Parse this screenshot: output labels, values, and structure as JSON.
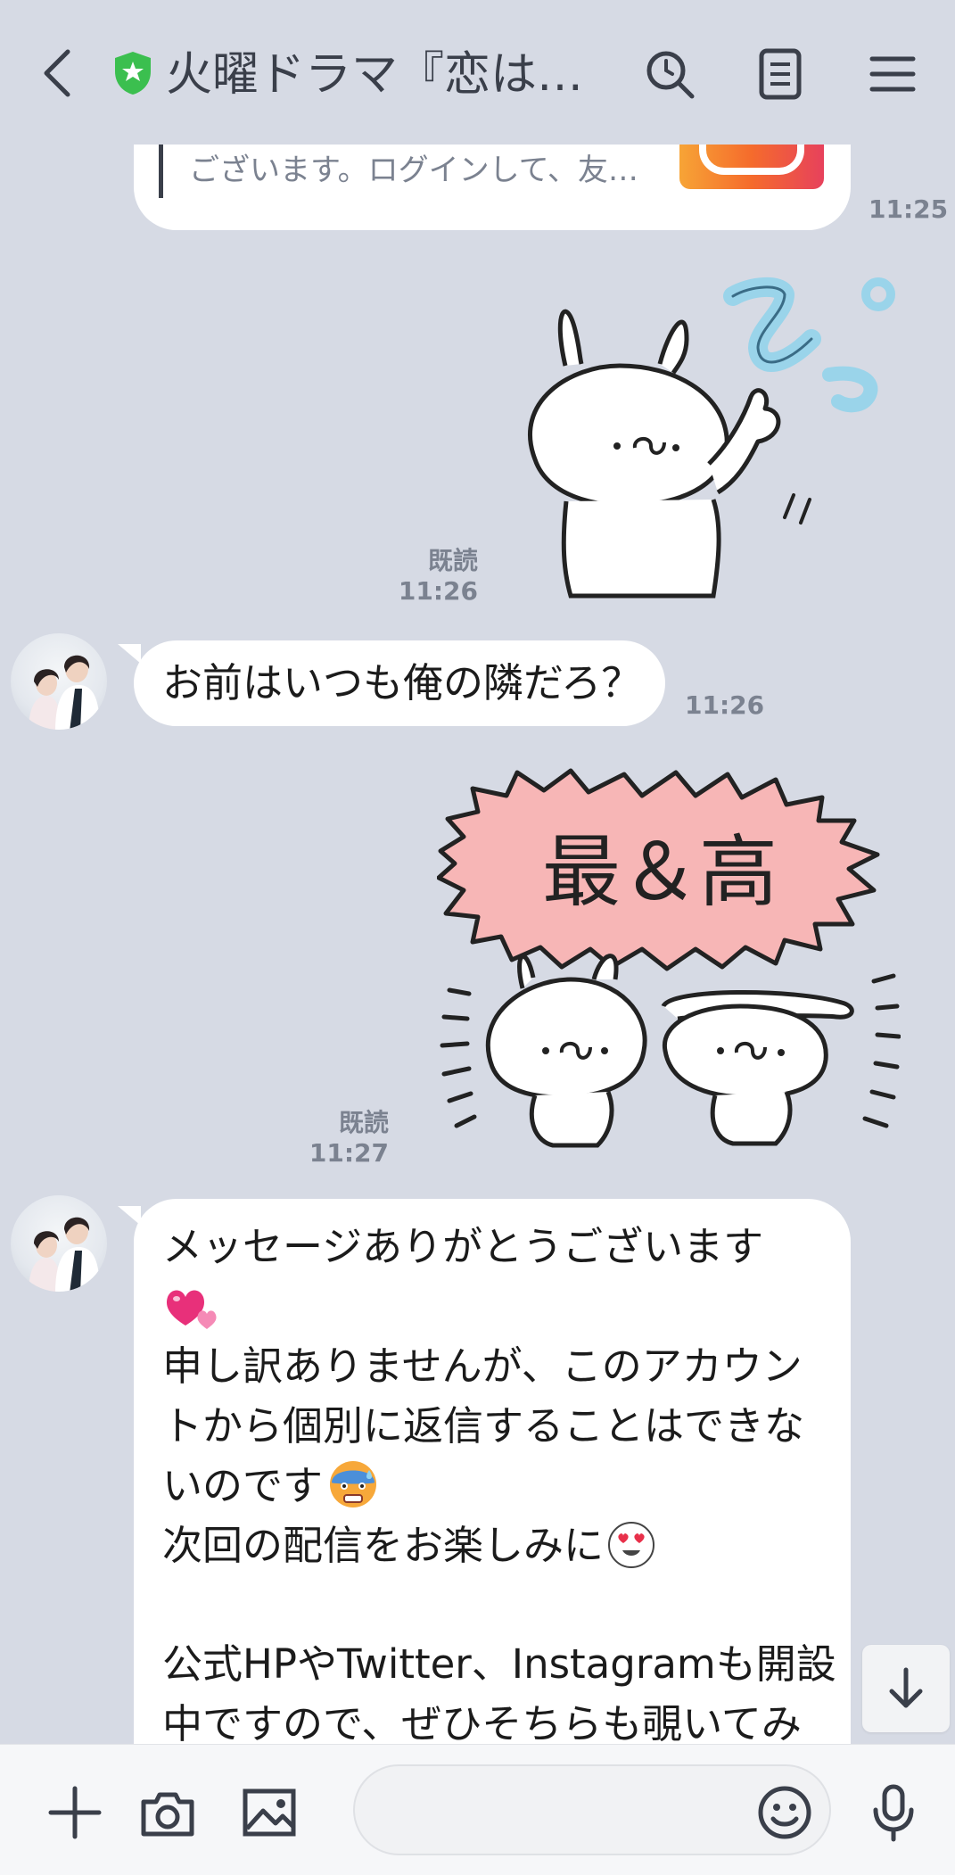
{
  "header": {
    "title": "火曜ドラマ『恋は…"
  },
  "messages": {
    "link_preview_text": "ございます。ログインして、友…",
    "link_preview_time": "11:25",
    "sticker1": {
      "read": "既読",
      "time": "11:26"
    },
    "msg2": {
      "text": "お前はいつも俺の隣だろ？",
      "time": "11:26"
    },
    "sticker2": {
      "read": "既読",
      "time": "11:27",
      "sticker_text": "最＆高"
    },
    "msg3": {
      "line1": "メッセージありがとうございます",
      "line2": "申し訳ありませんが、このアカウン",
      "line3": "トから個別に返信することはできな",
      "line4": "いのです",
      "line5": "次回の配信をお楽しみに",
      "line6": "公式HPやTwitter、Instagramも開設",
      "line7": "中ですので、ぜひそちらも覗いてみ"
    }
  },
  "icons": {
    "back": "back-arrow-icon",
    "verified": "verified-shield-icon",
    "search": "search-icon",
    "notes": "notes-icon",
    "menu": "menu-icon",
    "plus": "plus-icon",
    "camera": "camera-icon",
    "image": "image-icon",
    "emoji": "emoji-icon",
    "mic": "mic-icon",
    "scroll_down": "arrow-down-icon"
  },
  "colors": {
    "background": "#d6dae4",
    "bubble": "#ffffff",
    "verified_green": "#3bbf4f",
    "instagram_orange": "#f58529"
  }
}
